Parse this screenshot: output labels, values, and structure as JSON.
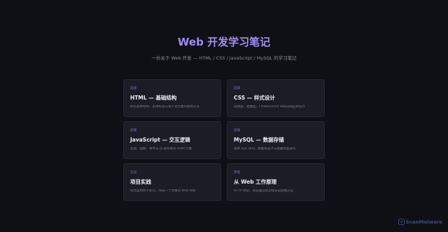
{
  "header": {
    "title": "Web 开发学习笔记",
    "subtitle": "一份关于 Web 开发 — HTML / CSS / JavaScript / MySQL 的学习笔记"
  },
  "cards": [
    {
      "tag": "前端",
      "title": "HTML — 基础结构",
      "desc": "网页基本结构、常用标签与语义化元素的使用方法"
    },
    {
      "tag": "前端",
      "title": "CSS — 样式设计",
      "desc": "选择器、盒模型、Flexbox/Grid 布局与响应式设计"
    },
    {
      "tag": "前端",
      "title": "JavaScript — 交互逻辑",
      "desc": "变量、函数、事件与 JS 操作网页 DOM 元素"
    },
    {
      "tag": "后端",
      "title": "MySQL — 数据存储",
      "desc": "基本 SQL 语句、数据表设计与增删改查操作"
    },
    {
      "tag": "实战",
      "title": "项目实践",
      "desc": "综合运用所学知识，完成一个完整的 Web 项目"
    },
    {
      "tag": "原理",
      "title": "从 Web 工作原理",
      "desc": "HTTP 协议、浏览器渲染流程与前后端交互"
    }
  ],
  "watermark": {
    "text": "ScanMalware",
    "icon": "scanmalware-logo-icon"
  }
}
